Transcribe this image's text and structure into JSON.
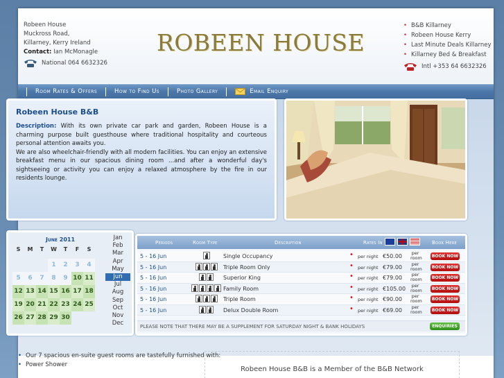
{
  "header": {
    "address": [
      "Robeen House",
      "Muckross Road,",
      "Killarney, Kerry Ireland"
    ],
    "contact_label": "Contact:",
    "contact_name": "Ian McMonagle",
    "phone_national": "National 064 6632326",
    "phone_intl": "Intl +353 64 6632326",
    "brand": "ROBEEN HOUSE",
    "links": [
      "B&B Killarney",
      "Robeen House Kerry",
      "Last Minute Deals Killarney",
      "Killarney Bed & Breakfast"
    ]
  },
  "nav": {
    "items": [
      "Room Rates & Offers",
      "How to Find Us",
      "Photo Gallery",
      "Email Enquiry"
    ]
  },
  "description": {
    "title": "Robeen House B&B",
    "label": "Description:",
    "para1": "With its own private car park and garden, Robeen House is a charming purpose built guesthouse where traditional hospitality and courteous personal attention awaits you.",
    "para2": "We are also wheelchair-friendly with all modern facilities. You can enjoy an extensive breakfast menu in our spacious dining room ...and after a wonderful day's sightseeing or activity you can enjoy a relaxed atmosphere by the fire in our residents lounge."
  },
  "calendar": {
    "title": "June 2011",
    "weekdays": [
      "S",
      "M",
      "T",
      "W",
      "T",
      "F",
      "S"
    ],
    "rows": [
      [
        "",
        "",
        "",
        "1",
        "2",
        "3",
        "4"
      ],
      [
        "5",
        "6",
        "7",
        "8",
        "9",
        "10",
        "11"
      ],
      [
        "12",
        "13",
        "14",
        "15",
        "16",
        "17",
        "18"
      ],
      [
        "19",
        "20",
        "21",
        "22",
        "23",
        "24",
        "25"
      ],
      [
        "26",
        "27",
        "28",
        "29",
        "30",
        "",
        ""
      ]
    ],
    "months": [
      "Jan",
      "Feb",
      "Mar",
      "Apr",
      "May",
      "Jun",
      "Jul",
      "Aug",
      "Sep",
      "Oct",
      "Nov",
      "Dec"
    ],
    "current_month": "Jun"
  },
  "rates": {
    "headers": {
      "periods": "Periods",
      "room_type": "Room Type",
      "description": "Description",
      "rates_in": "Rates In",
      "book_here": "Book Here"
    },
    "rows": [
      {
        "period": "5 - 16 Jun",
        "persons": 1,
        "description": "Single Occupancy",
        "per": "per night",
        "price": "€50.00",
        "unit": "per room",
        "button": "BOOK NOW"
      },
      {
        "period": "5 - 16 Jun",
        "persons": 3,
        "description": "Triple Room Only",
        "per": "per night",
        "price": "€79.00",
        "unit": "per room",
        "button": "BOOK NOW"
      },
      {
        "period": "5 - 16 Jun",
        "persons": 2,
        "description": "Superior King",
        "per": "per night",
        "price": "€79.00",
        "unit": "per room",
        "button": "BOOK NOW"
      },
      {
        "period": "5 - 16 Jun",
        "persons": 4,
        "description": "Family Room",
        "per": "per night",
        "price": "€105.00",
        "unit": "per room",
        "button": "BOOK NOW"
      },
      {
        "period": "5 - 16 Jun",
        "persons": 3,
        "description": "Triple Room",
        "per": "per night",
        "price": "€90.00",
        "unit": "per room",
        "button": "BOOK NOW"
      },
      {
        "period": "5 - 16 Jun",
        "persons": 2,
        "description": "Delux Double Room",
        "per": "per night",
        "price": "€69.00",
        "unit": "per room",
        "button": "BOOK NOW"
      }
    ],
    "note": "PLEASE NOTE THAT THERE MAY BE A SUPPLEMENT FOR SATURDAY NIGHT & BANK HOLIDAYS",
    "enquiries": "ENQUIRIES"
  },
  "bottom": {
    "list": [
      "Our 7 spacious en-suite guest rooms are tastefully furnished with:",
      "Power Shower"
    ],
    "member": "Robeen House B&B is a Member of the B&B Network"
  },
  "colors": {
    "nav": "#4c78a9",
    "accent": "#1c4e8c",
    "book": "#c41c1c",
    "brand": "#8a7a3c"
  },
  "icons": [
    "phone-icon",
    "mail-icon",
    "flag-eu-icon",
    "flag-uk-icon",
    "flag-us-icon",
    "person-icon"
  ]
}
